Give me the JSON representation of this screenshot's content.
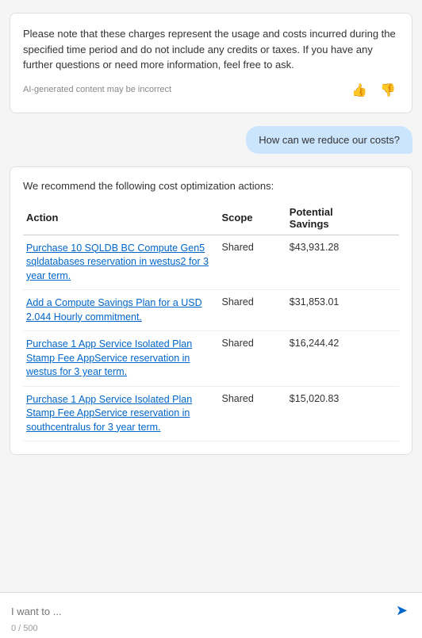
{
  "ai_message_1": {
    "text": "Please note that these charges represent the usage and costs incurred during the specified time period and do not include any credits or taxes. If you have any further questions or need more information, feel free to ask.",
    "disclaimer": "AI-generated content may be incorrect"
  },
  "user_message": {
    "text": "How can we reduce our costs?"
  },
  "ai_message_2": {
    "intro": "We recommend the following cost optimization actions:",
    "table": {
      "headers": [
        "Action",
        "Scope",
        "Potential Savings"
      ],
      "rows": [
        {
          "action": "Purchase 10 SQLDB BC Compute Gen5 sqldatabases reservation in westus2 for 3 year term.",
          "scope": "Shared",
          "savings": "$43,931.28"
        },
        {
          "action": "Add a Compute Savings Plan for a USD 2.044 Hourly commitment.",
          "scope": "Shared",
          "savings": "$31,853.01"
        },
        {
          "action": "Purchase 1 App Service Isolated Plan Stamp Fee AppService reservation in westus for 3 year term.",
          "scope": "Shared",
          "savings": "$16,244.42"
        },
        {
          "action": "Purchase 1 App Service Isolated Plan Stamp Fee AppService reservation in southcentralus for 3 year term.",
          "scope": "Shared",
          "savings": "$15,020.83"
        }
      ]
    }
  },
  "input": {
    "placeholder": "I want to ...",
    "char_count": "0 / 500"
  },
  "icons": {
    "thumbs_up": "👍",
    "thumbs_down": "👎",
    "send": "▷"
  }
}
